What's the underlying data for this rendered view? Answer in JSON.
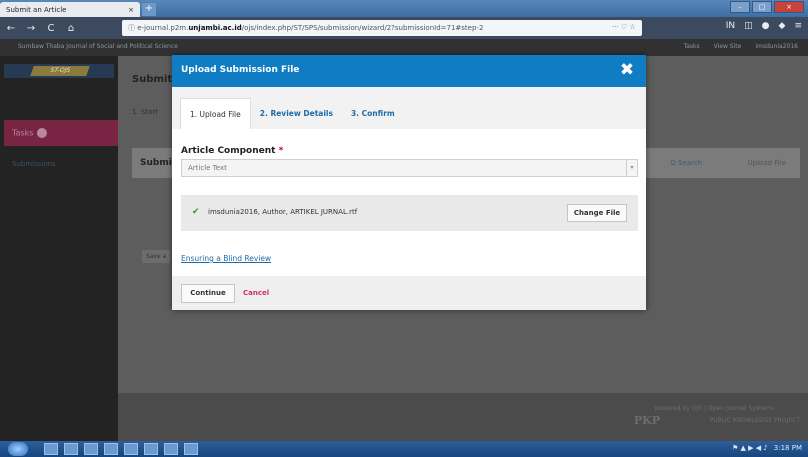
{
  "browser": {
    "tab_title": "Submit an Article",
    "tab_close": "×",
    "new_tab": "+",
    "window_controls": {
      "minimize": "–",
      "maximize": "□",
      "close": "×"
    },
    "back": "←",
    "forward": "→",
    "reload": "C",
    "home": "⌂",
    "url_prefix": "ⓘ e-journal.p2m.",
    "url_host": "unjambi.ac.id",
    "url_rest": "/ojs/index.php/ST/SPS/submission/wizard/2?submissionId=71#step-2",
    "url_actions": "··· ♡ ☆",
    "toolbar_icons": [
      "IN",
      "◫",
      "●",
      "◆",
      "≡"
    ]
  },
  "page": {
    "journal_name": "Sumbaw Thaba Journal of Social and Political Science",
    "top_right": [
      "Tasks",
      "View Site",
      "imsdunia2016"
    ],
    "brand_logo": "ST-OJS",
    "tasks_label": "Tasks",
    "submissions_link": "Submissions",
    "content_title": "Submit",
    "content_step": "1. Start",
    "card_title": "Submi",
    "search_link": "Q Search",
    "upload_link": "Upload File",
    "save_btn": "Save a",
    "footer_line1": "powered by OJS | Open Journal Systems",
    "footer_pkp": "PKP",
    "footer_line2": "PUBLIC KNOWLEDGE PROJECT"
  },
  "modal": {
    "title": "Upload Submission File",
    "close": "✖",
    "tabs": [
      {
        "label": "1. Upload File"
      },
      {
        "label": "2. Review Details"
      },
      {
        "label": "3. Confirm"
      }
    ],
    "component_label": "Article Component",
    "required_mark": "*",
    "component_value": "Article Text",
    "select_arrow": "▾",
    "check_mark": "✔",
    "file_name": "imsdunia2016, Author, ARTIKEL JURNAL.rtf",
    "change_file": "Change File",
    "blind_review_link": "Ensuring a Blind Review",
    "continue": "Continue",
    "cancel": "Cancel"
  },
  "taskbar": {
    "tray_text": "⚑ ▲ ▶ ◀ ♪",
    "clock": "3:18 PM"
  },
  "colors": {
    "modal_header": "#0f7cc3",
    "link": "#1e6ba9",
    "required": "#d0021b",
    "cancel": "#d0306a",
    "check": "#1aa33a"
  }
}
